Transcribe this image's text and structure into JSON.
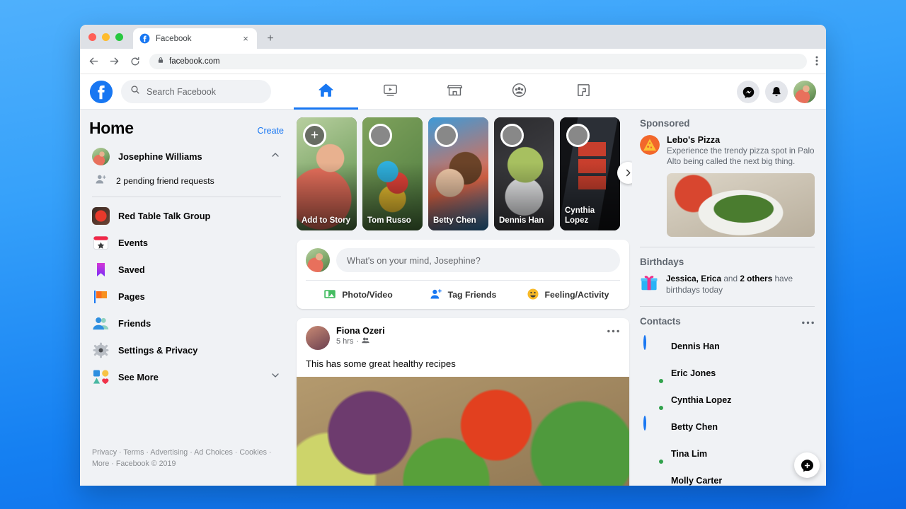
{
  "browser": {
    "tab_title": "Facebook",
    "tab_favicon": "facebook-icon",
    "close_label": "×",
    "new_tab_label": "+",
    "url": "facebook.com",
    "lock_icon": "lock-icon",
    "back_icon": "back-arrow-icon",
    "forward_icon": "forward-arrow-icon",
    "reload_icon": "reload-icon",
    "menu_icon": "kebab-menu-icon"
  },
  "topbar": {
    "logo": "facebook-logo-icon",
    "search_placeholder": "Search Facebook",
    "search_icon": "search-icon",
    "nav": [
      {
        "name": "home",
        "icon": "home-icon",
        "active": true
      },
      {
        "name": "watch",
        "icon": "watch-video-icon",
        "active": false
      },
      {
        "name": "marketplace",
        "icon": "marketplace-store-icon",
        "active": false
      },
      {
        "name": "groups",
        "icon": "groups-icon",
        "active": false
      },
      {
        "name": "gaming",
        "icon": "gaming-icon",
        "active": false
      }
    ],
    "actions": [
      {
        "name": "messenger",
        "icon": "messenger-icon"
      },
      {
        "name": "notifications",
        "icon": "bell-icon"
      },
      {
        "name": "profile",
        "icon": "avatar"
      }
    ]
  },
  "sidebar": {
    "title": "Home",
    "create_label": "Create",
    "profile": {
      "name": "Josephine Williams",
      "collapse_icon": "chevron-up-icon"
    },
    "pending": {
      "label": "2 pending friend requests",
      "icon": "friend-request-icon"
    },
    "items": [
      {
        "label": "Red Table Talk Group",
        "icon": "group-thumbnail-icon"
      },
      {
        "label": "Events",
        "icon": "events-calendar-icon"
      },
      {
        "label": "Saved",
        "icon": "saved-bookmark-icon"
      },
      {
        "label": "Pages",
        "icon": "pages-flag-icon"
      },
      {
        "label": "Friends",
        "icon": "friends-icon"
      },
      {
        "label": "Settings & Privacy",
        "icon": "settings-gear-icon"
      },
      {
        "label": "See More",
        "icon": "see-more-shapes-icon",
        "expand_icon": "chevron-down-icon"
      }
    ],
    "footer": {
      "links": [
        "Privacy",
        "Terms",
        "Advertising",
        "Ad Choices",
        "Cookies",
        "More"
      ],
      "copyright": "Facebook © 2019",
      "separator": " · "
    }
  },
  "stories": {
    "next_icon": "chevron-right-icon",
    "items": [
      {
        "name": "Add to Story",
        "type": "add",
        "add_icon": "plus-icon",
        "thumb": "ph-girl"
      },
      {
        "name": "Tom Russo",
        "type": "story",
        "thumb": "ph-parrot",
        "avatar": "ph-p1"
      },
      {
        "name": "Betty Chen",
        "type": "story",
        "thumb": "ph-two-girls",
        "avatar": "ph-p3"
      },
      {
        "name": "Dennis Han",
        "type": "story",
        "thumb": "ph-plant",
        "avatar": "ph-p2"
      },
      {
        "name": "Cynthia Lopez",
        "type": "story",
        "thumb": "ph-market-sign",
        "avatar": "ph-p5"
      }
    ]
  },
  "composer": {
    "placeholder": "What's on your mind, Josephine?",
    "avatar": "avatar",
    "actions": [
      {
        "label": "Photo/Video",
        "icon": "photo-video-icon"
      },
      {
        "label": "Tag Friends",
        "icon": "tag-friends-icon"
      },
      {
        "label": "Feeling/Activity",
        "icon": "feeling-activity-icon"
      }
    ]
  },
  "post": {
    "author": "Fiona Ozeri",
    "time": "5 hrs",
    "audience_icon": "friends-audience-icon",
    "meta_separator": "·",
    "menu_icon": "more-options-icon",
    "text": "This has some great healthy recipes",
    "image": "farmers-market-produce"
  },
  "right": {
    "sponsored": {
      "heading": "Sponsored",
      "title": "Lebo's Pizza",
      "description": "Experience the trendy pizza spot in Palo Alto being called the next big thing.",
      "logo_icon": "pizza-brand-icon",
      "image": "pizza-photo"
    },
    "birthdays": {
      "heading": "Birthdays",
      "icon": "gift-icon",
      "names": "Jessica, Erica",
      "connector": " and ",
      "others": "2 others",
      "suffix": " have birthdays today"
    },
    "contacts": {
      "heading": "Contacts",
      "menu_icon": "more-options-icon",
      "new_message_icon": "new-message-icon",
      "items": [
        {
          "name": "Dennis Han",
          "active_story": true,
          "online": false,
          "thumb": "ph-p2"
        },
        {
          "name": "Eric Jones",
          "active_story": false,
          "online": true,
          "thumb": "ph-p1"
        },
        {
          "name": "Cynthia Lopez",
          "active_story": false,
          "online": true,
          "thumb": "ph-p5"
        },
        {
          "name": "Betty Chen",
          "active_story": true,
          "online": false,
          "thumb": "ph-p3"
        },
        {
          "name": "Tina Lim",
          "active_story": false,
          "online": true,
          "thumb": "ph-p4"
        },
        {
          "name": "Molly Carter",
          "active_story": false,
          "online": false,
          "thumb": "ph-p6"
        }
      ]
    }
  },
  "colors": {
    "brand_blue": "#1877f2",
    "page_bg": "#f0f2f5",
    "text_primary": "#050505",
    "text_secondary": "#65676b",
    "online_green": "#31a24c"
  }
}
